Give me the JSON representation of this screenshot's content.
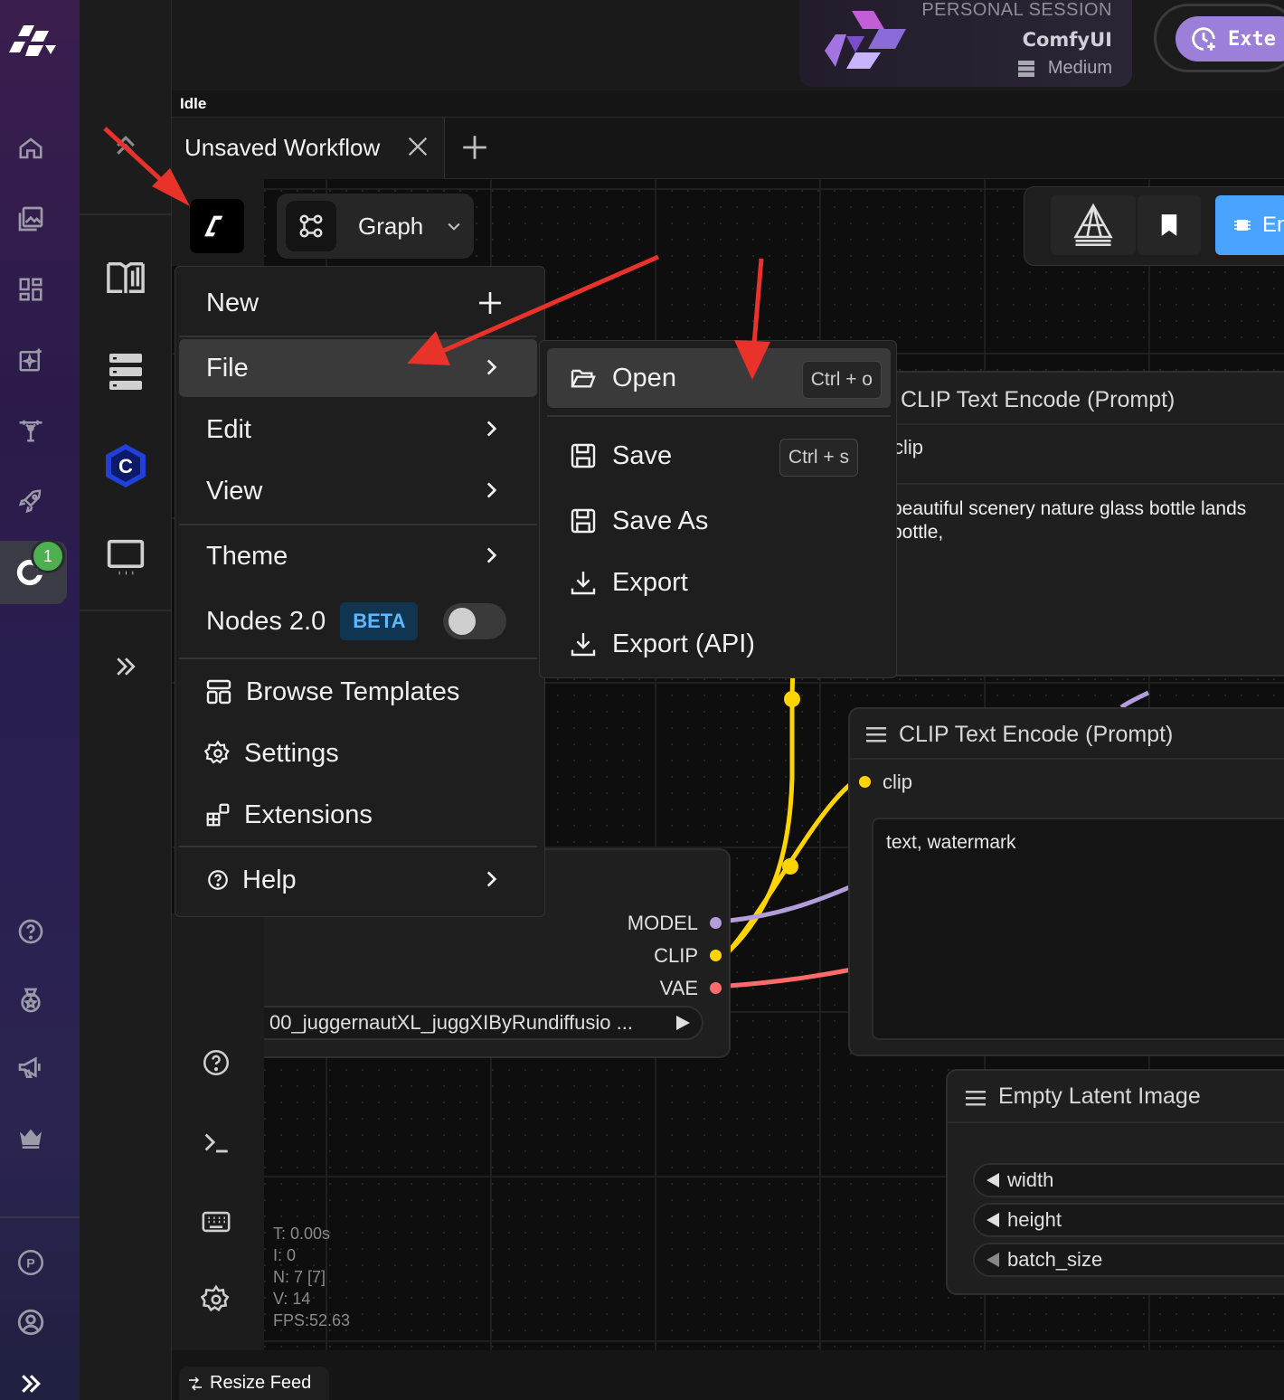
{
  "session": {
    "label": "PERSONAL SESSION",
    "app": "ComfyUI",
    "tier": "Medium"
  },
  "ext_button": {
    "label": "Exte"
  },
  "status": "Idle",
  "tabs": [
    {
      "label": "Unsaved Workflow"
    }
  ],
  "graph_switch": {
    "label": "Graph"
  },
  "canvas_toolbar": {
    "en_label": "En"
  },
  "main_menu": {
    "new": "New",
    "file": "File",
    "edit": "Edit",
    "view": "View",
    "theme": "Theme",
    "nodes": "Nodes 2.0",
    "nodes_badge": "BETA",
    "browse_templates": "Browse Templates",
    "settings": "Settings",
    "extensions": "Extensions",
    "help": "Help"
  },
  "file_menu": {
    "open": "Open",
    "open_kbd": "Ctrl + o",
    "save": "Save",
    "save_kbd": "Ctrl + s",
    "save_as": "Save As",
    "export": "Export",
    "export_api": "Export (API)"
  },
  "nodes": {
    "clip1": {
      "title": "CLIP Text Encode (Prompt)",
      "input": "clip",
      "text_line1": "beautiful scenery nature glass bottle lands",
      "text_line2": "bottle,"
    },
    "clip2": {
      "title": "CLIP Text Encode (Prompt)",
      "input": "clip",
      "text": "text, watermark"
    },
    "checkpoint": {
      "out_model": "MODEL",
      "out_clip": "CLIP",
      "out_vae": "VAE",
      "ckpt": "00_juggernautXL_juggXIByRundiffusio ..."
    },
    "latent": {
      "title": "Empty Latent Image",
      "w": "width",
      "h": "height",
      "b": "batch_size"
    }
  },
  "stats": {
    "t": "T: 0.00s",
    "i": "I: 0",
    "n": "N: 7 [7]",
    "v": "V: 14",
    "fps": "FPS:52.63"
  },
  "rail_badge": "1",
  "resize_feed": "Resize Feed",
  "colors": {
    "accent": "#9b7fd8",
    "blue": "#4aa3ff",
    "clip": "#ffd400",
    "model": "#b39ddb",
    "vae": "#ff6b6b",
    "arrow": "#e8322a"
  }
}
